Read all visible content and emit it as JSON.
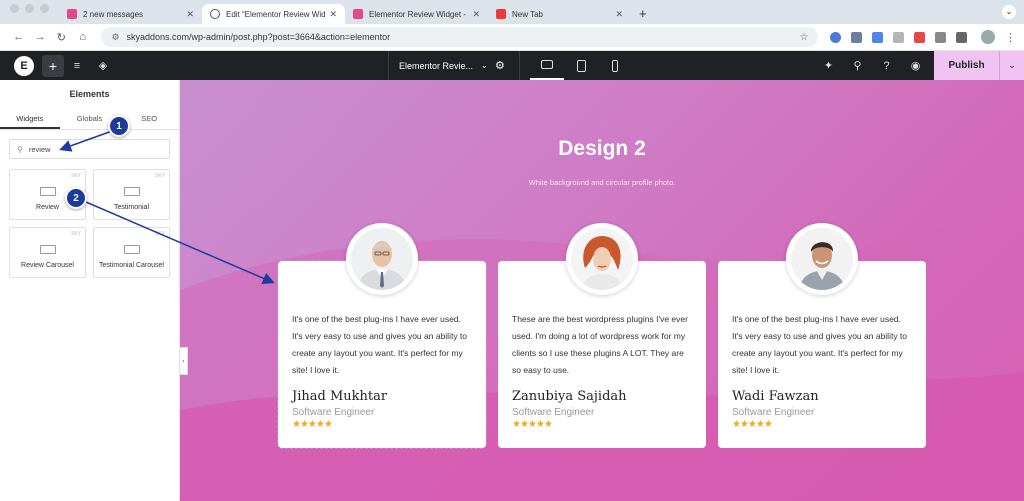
{
  "browser": {
    "tabs": [
      {
        "title": "2 new messages",
        "icon": "pink-app-icon"
      },
      {
        "title": "Edit “Elementor Review Widge",
        "icon": "globe-icon"
      },
      {
        "title": "Elementor Review Widget - S",
        "icon": "pink-app-icon"
      },
      {
        "title": "New Tab",
        "icon": "red-app-icon"
      }
    ],
    "new_tab_label": "+",
    "url": "skyaddons.com/wp-admin/post.php?post=3664&action=elementor"
  },
  "editor": {
    "document_title": "Elementor Revie...",
    "publish_label": "Publish"
  },
  "panel": {
    "title": "Elements",
    "tabs": [
      "Widgets",
      "Globals",
      "SEO"
    ],
    "active_tab": "Widgets",
    "search_value": "review",
    "widgets": [
      {
        "label": "Review",
        "badge": "SKY"
      },
      {
        "label": "Testimonial",
        "badge": "SKY"
      },
      {
        "label": "Review Carousel",
        "badge": "SKY"
      },
      {
        "label": "Testimonial Carousel",
        "badge": "SKY"
      }
    ]
  },
  "canvas": {
    "title": "Design 2",
    "subtitle": "White background and circular profile photo.",
    "cards": [
      {
        "quote": "It's one of the best plug-ins I have ever used. It's very easy to use and gives you an ability to create any layout you want. It's perfect for my site! I love it.",
        "name": "Jihad Mukhtar",
        "role": "Software Engineer",
        "stars": "★★★★★",
        "rating": 5
      },
      {
        "quote": "These are the best wordpress plugins I've ever used. I'm doing a lot of wordpress work for my clients so I use these plugins A LOT. They are so easy to use.",
        "name": "Zanubiya Sajidah",
        "role": "Software Engineer",
        "stars": "★★★★★",
        "rating": 5
      },
      {
        "quote": "It's one of the best plug-ins I have ever used. It's very easy to use and gives you an ability to create any layout you want. It's perfect for my site! I love it.",
        "name": "Wadi Fawzan",
        "role": "Software Engineer",
        "stars": "★★★★★",
        "rating": 5
      }
    ]
  },
  "annotations": {
    "step1": "1",
    "step2": "2",
    "color": "#1d3a9e"
  },
  "colors": {
    "publish_bg": "#f0c4f2",
    "editor_bar": "#1f2124",
    "star": "#f2a91b"
  }
}
